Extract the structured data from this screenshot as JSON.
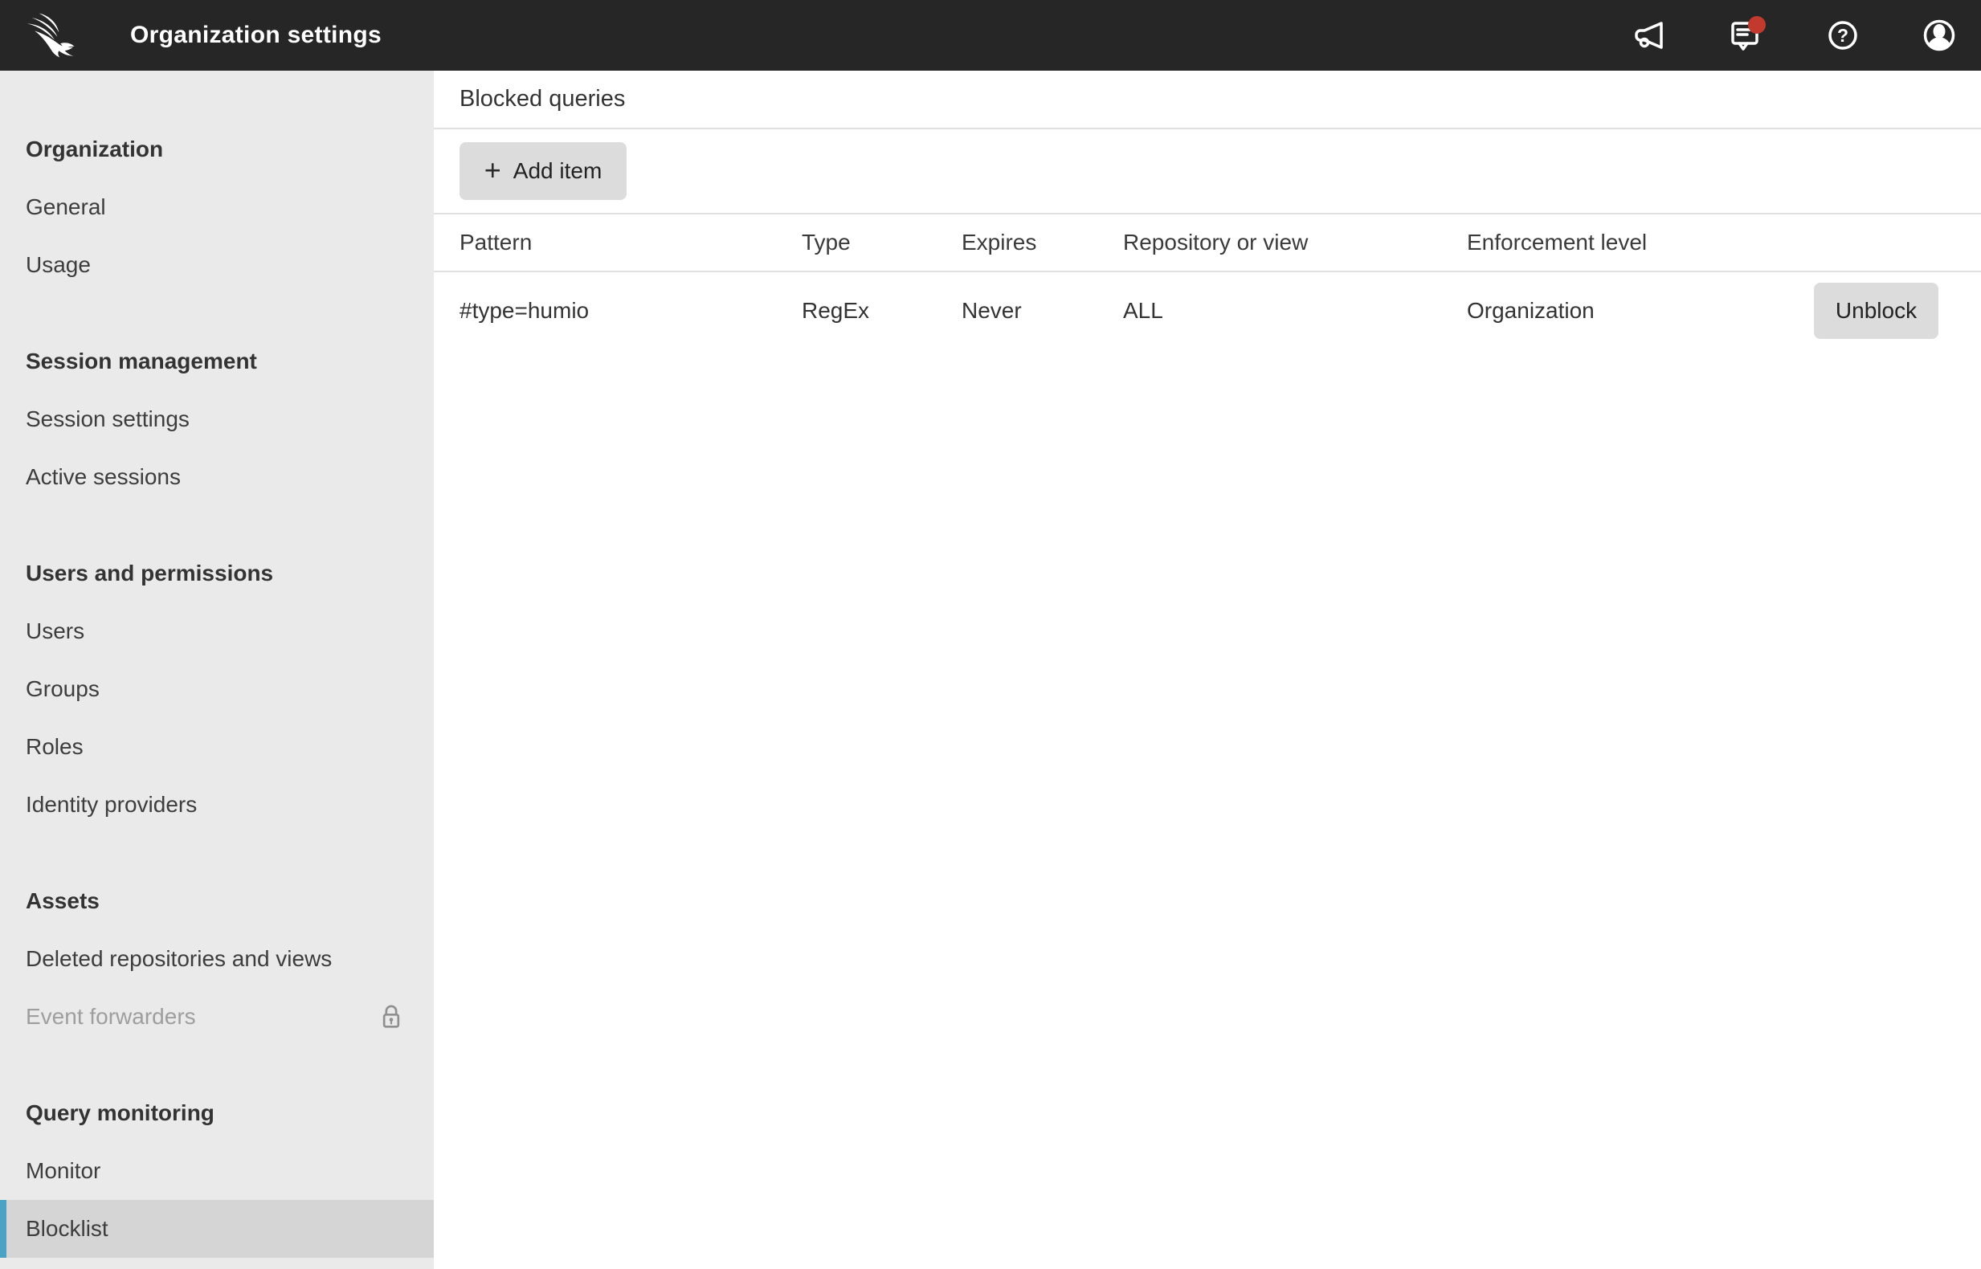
{
  "topbar": {
    "title": "Organization settings",
    "logo": "crowdstrike-falcon",
    "help_glyph": "?",
    "has_unread_notification": true
  },
  "colors": {
    "topbar_bg": "#262626",
    "sidebar_bg": "#eaeaea",
    "selected_item_bg": "#d5d5d5",
    "accent_teal": "#4ba3c3",
    "notification_red": "#c13a2d",
    "border": "#e0e0e0",
    "button_bg": "#dcdcdc",
    "disabled_text": "#9e9e9e"
  },
  "sidebar": {
    "sections": [
      {
        "header": "Organization",
        "items": [
          {
            "label": "General"
          },
          {
            "label": "Usage"
          }
        ]
      },
      {
        "header": "Session management",
        "items": [
          {
            "label": "Session settings"
          },
          {
            "label": "Active sessions"
          }
        ]
      },
      {
        "header": "Users and permissions",
        "items": [
          {
            "label": "Users"
          },
          {
            "label": "Groups"
          },
          {
            "label": "Roles"
          },
          {
            "label": "Identity providers"
          }
        ]
      },
      {
        "header": "Assets",
        "items": [
          {
            "label": "Deleted repositories and views"
          },
          {
            "label": "Event forwarders",
            "disabled": true,
            "locked": true
          }
        ]
      },
      {
        "header": "Query monitoring",
        "items": [
          {
            "label": "Monitor"
          },
          {
            "label": "Blocklist",
            "selected": true
          }
        ]
      }
    ]
  },
  "main": {
    "heading": "Blocked queries",
    "toolbar": {
      "plus_glyph": "+",
      "add_item_label": "Add item"
    },
    "table": {
      "columns": [
        "Pattern",
        "Type",
        "Expires",
        "Repository or view",
        "Enforcement level"
      ],
      "rows": [
        {
          "pattern": "#type=humio",
          "type": "RegEx",
          "expires": "Never",
          "repository_or_view": "ALL",
          "enforcement_level": "Organization",
          "action_label": "Unblock"
        }
      ]
    }
  }
}
